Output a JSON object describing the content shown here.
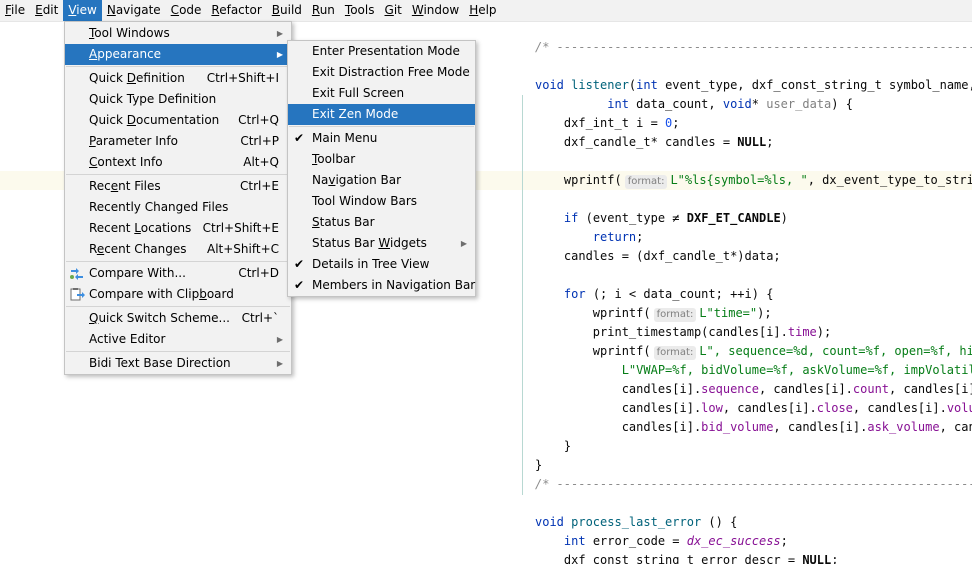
{
  "menubar": {
    "items": [
      {
        "label": "File",
        "accel": "F",
        "rest": "ile"
      },
      {
        "label": "Edit",
        "accel": "E",
        "rest": "dit"
      },
      {
        "label": "View",
        "accel": "V",
        "rest": "iew"
      },
      {
        "label": "Navigate",
        "accel": "N",
        "rest": "avigate"
      },
      {
        "label": "Code",
        "accel": "C",
        "rest": "ode"
      },
      {
        "label": "Refactor",
        "accel": "R",
        "rest": "efactor"
      },
      {
        "label": "Build",
        "accel": "B",
        "rest": "uild"
      },
      {
        "label": "Run",
        "accel": "R",
        "rest": "un"
      },
      {
        "label": "Tools",
        "accel": "T",
        "rest": "ools"
      },
      {
        "label": "Git",
        "accel": "G",
        "rest": "it"
      },
      {
        "label": "Window",
        "accel": "W",
        "rest": "indow"
      },
      {
        "label": "Help",
        "accel": "H",
        "rest": "elp"
      }
    ]
  },
  "view_menu": {
    "items": [
      {
        "pre": "",
        "accel": "T",
        "rest": "ool Windows",
        "shortcut": "",
        "submenu": true
      },
      {
        "pre": "",
        "accel": "A",
        "rest": "ppearance",
        "shortcut": "",
        "submenu": true
      },
      {
        "pre": "Quick ",
        "accel": "D",
        "rest": "efinition",
        "shortcut": "Ctrl+Shift+I"
      },
      {
        "pre": "Quick Type Definition",
        "accel": "",
        "rest": "",
        "shortcut": ""
      },
      {
        "pre": "Quick ",
        "accel": "D",
        "rest": "ocumentation",
        "shortcut": "Ctrl+Q"
      },
      {
        "pre": "",
        "accel": "P",
        "rest": "arameter Info",
        "shortcut": "Ctrl+P"
      },
      {
        "pre": "",
        "accel": "C",
        "rest": "ontext Info",
        "shortcut": "Alt+Q"
      },
      {
        "pre": "Rec",
        "accel": "e",
        "rest": "nt Files",
        "shortcut": "Ctrl+E"
      },
      {
        "pre": "Recently Changed Files",
        "accel": "",
        "rest": "",
        "shortcut": ""
      },
      {
        "pre": "Recent ",
        "accel": "L",
        "rest": "ocations",
        "shortcut": "Ctrl+Shift+E"
      },
      {
        "pre": "R",
        "accel": "e",
        "rest": "cent Changes",
        "shortcut": "Alt+Shift+C"
      },
      {
        "pre": "Compare With...",
        "accel": "",
        "rest": "",
        "shortcut": "Ctrl+D"
      },
      {
        "pre": "Compare with Clip",
        "accel": "b",
        "rest": "oard",
        "shortcut": ""
      },
      {
        "pre": "",
        "accel": "Q",
        "rest": "uick Switch Scheme...",
        "shortcut": "Ctrl+`"
      },
      {
        "pre": "Active Editor",
        "accel": "",
        "rest": "",
        "shortcut": "",
        "submenu": true
      },
      {
        "pre": "Bidi Text Base Direction",
        "accel": "",
        "rest": "",
        "shortcut": "",
        "submenu": true
      }
    ]
  },
  "appearance_menu": {
    "items": [
      {
        "pre": "Enter Presentation Mode",
        "accel": "",
        "rest": "",
        "checked": false
      },
      {
        "pre": "Exit Distraction Free Mode",
        "accel": "",
        "rest": "",
        "checked": false
      },
      {
        "pre": "Exit Full Screen",
        "accel": "",
        "rest": "",
        "checked": false
      },
      {
        "pre": "Exit Zen Mode",
        "accel": "",
        "rest": "",
        "checked": false
      },
      {
        "pre": "Main Menu",
        "accel": "",
        "rest": "",
        "checked": true
      },
      {
        "pre": "",
        "accel": "T",
        "rest": "oolbar",
        "checked": true
      },
      {
        "pre": "Na",
        "accel": "v",
        "rest": "igation Bar",
        "checked": false
      },
      {
        "pre": "Tool Window Bars",
        "accel": "",
        "rest": "",
        "checked": false
      },
      {
        "pre": "",
        "accel": "S",
        "rest": "tatus Bar",
        "checked": false
      },
      {
        "pre": "Status Bar ",
        "accel": "W",
        "rest": "idgets",
        "checked": false,
        "submenu": true
      },
      {
        "pre": "Details in Tree View",
        "accel": "",
        "rest": "",
        "checked": true
      },
      {
        "pre": "Members in Navigation Bar",
        "accel": "",
        "rest": "",
        "checked": true
      }
    ]
  },
  "code": {
    "comment1": "/* ----------------------------------------------------------------------",
    "l1a": "void ",
    "l1b": "listener",
    "l1c": "(",
    "l1d": "int ",
    "l1e": "event_type, dxf_const_string_t symbol_name, c",
    "l2a": "          ",
    "l2b": "int ",
    "l2c": "data_count, ",
    "l2d": "void",
    "l2e": "* ",
    "l2f": "user_data",
    "l2g": ") {",
    "l3a": "    dxf_int_t i = ",
    "l3b": "0",
    "l3c": ";",
    "l4a": "    dxf_candle_t* candles = ",
    "l4b": "NULL",
    "l4c": ";",
    "l5a": "    wprintf(",
    "l5hint": "format:",
    "l5b": "L\"%ls{symbol=%ls, \"",
    "l5c": ", dx_event_type_to_strin",
    "l6a": "    ",
    "l6b": "if ",
    "l6c": "(event_type ≠ ",
    "l6d": "DXF_ET_CANDLE",
    "l6e": ")",
    "l7a": "        ",
    "l7b": "return",
    "l7c": ";",
    "l8": "    candles = (dxf_candle_t*)data;",
    "l9a": "    ",
    "l9b": "for ",
    "l9c": "(; i < data_count; ++i) {",
    "l10a": "        wprintf(",
    "l10hint": "format:",
    "l10b": "L\"time=\"",
    "l10c": ");",
    "l11a": "        print_timestamp(candles[i].",
    "l11b": "time",
    "l11c": ");",
    "l12a": "        wprintf(",
    "l12hint": "format:",
    "l12b": "L\", sequence=%d, count=%f, open=%f, hig",
    "l13a": "            ",
    "l13b": "L\"VWAP=%f, bidVolume=%f, askVolume=%f, impVolatilit",
    "l14a": "            candles[i].",
    "l14b": "sequence",
    "l14c": ", candles[i].",
    "l14d": "count",
    "l14e": ", candles[i].c",
    "l15a": "            candles[i].",
    "l15b": "low",
    "l15c": ", candles[i].",
    "l15d": "close",
    "l15e": ", candles[i].",
    "l15f": "volume",
    "l16a": "            candles[i].",
    "l16b": "bid_volume",
    "l16c": ", candles[i].",
    "l16d": "ask_volume",
    "l16e": ", cand",
    "l17": "    }",
    "l18": "}",
    "comment2": "/* ----------------------------------------------------------------------",
    "l19a": "void ",
    "l19b": "process_last_error ",
    "l19c": "() {",
    "l20a": "    ",
    "l20b": "int ",
    "l20c": "error_code = ",
    "l20d": "dx_ec_success",
    "l20e": ";",
    "l21a": "    dxf_const_string_t error_descr = ",
    "l21b": "NULL",
    "l21c": ";"
  }
}
